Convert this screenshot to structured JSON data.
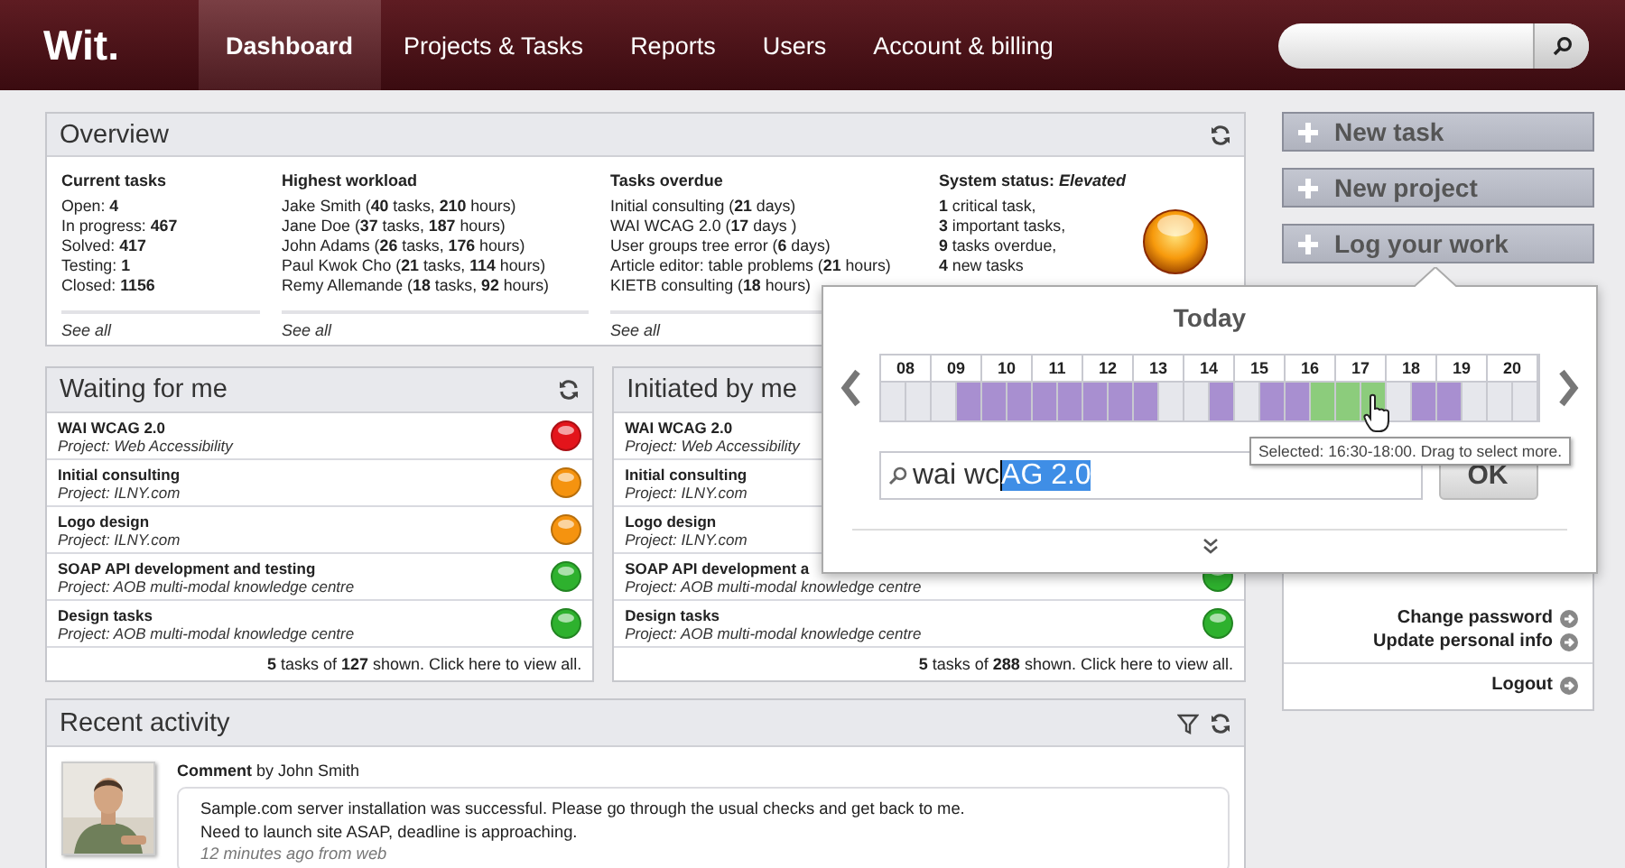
{
  "header": {
    "logo": "Wit.",
    "nav": [
      {
        "label": "Dashboard",
        "selected": true
      },
      {
        "label": "Projects & Tasks",
        "selected": false
      },
      {
        "label": "Reports",
        "selected": false
      },
      {
        "label": "Users",
        "selected": false
      },
      {
        "label": "Account & billing",
        "selected": false
      }
    ]
  },
  "overview": {
    "title": "Overview",
    "columns": [
      {
        "title": "Current tasks",
        "lines": [
          "Open: **4**",
          "In progress: **467**",
          "Solved: **417**",
          "Testing: **1**",
          "Closed: **1156**"
        ],
        "link": "See all"
      },
      {
        "title": "Highest workload",
        "lines": [
          "Jake Smith (**40** tasks, **210** hours)",
          "Jane Doe (**37** tasks, **187** hours)",
          "John Adams (**26** tasks, **176** hours)",
          "Paul Kwok Cho (**21** tasks, **114** hours)",
          "Remy Allemande (**18** tasks, **92** hours)"
        ],
        "link": "See all"
      },
      {
        "title": "Tasks overdue",
        "lines": [
          "Initial consulting (**21** days)",
          "WAI WCAG 2.0 (**17** days )",
          "User groups tree error (**6** days)",
          "Article editor: table problems (**21** hours)",
          "KIETB consulting (**18** hours)"
        ],
        "link": "See all"
      },
      {
        "title": "System status: *Elevated*",
        "lines": [
          "**1** critical task,",
          "**3** important tasks,",
          "**9** tasks overdue,",
          "**4** new tasks"
        ],
        "kind": "status"
      }
    ]
  },
  "panels": [
    {
      "title": "Waiting for me",
      "refresh": true,
      "rows": [
        {
          "title": "WAI WCAG 2.0",
          "project": "Project: Web Accessibility",
          "color": "#e3141b"
        },
        {
          "title": "Initial consulting",
          "project": "Project: ILNY.com",
          "color": "#f5930f"
        },
        {
          "title": "Logo design",
          "project": "Project: ILNY.com",
          "color": "#f5930f"
        },
        {
          "title": "SOAP API development and testing",
          "project": "Project: AOB multi-modal knowledge centre",
          "color": "#2eb12e"
        },
        {
          "title": "Design tasks",
          "project": "Project: AOB multi-modal knowledge centre",
          "color": "#2eb12e"
        }
      ],
      "footer": "**5** tasks of **127** shown. Click here to view all."
    },
    {
      "title": "Initiated by me",
      "rows": [
        {
          "title": "WAI WCAG 2.0",
          "project": "Project: Web Accessibility"
        },
        {
          "title": "Initial consulting",
          "project": "Project: ILNY.com"
        },
        {
          "title": "Logo design",
          "project": "Project: ILNY.com"
        },
        {
          "title": "SOAP API development a",
          "project": "Project: AOB multi-modal knowledge centre",
          "color": "#2eb12e"
        },
        {
          "title": "Design tasks",
          "project": "Project: AOB multi-modal knowledge centre",
          "color": "#2eb12e"
        }
      ],
      "footer": "**5** tasks of **288** shown. Click here to view all."
    }
  ],
  "activity": {
    "title": "Recent activity",
    "entries": [
      {
        "kind": "picture",
        "heading": "**Comment** by John Smith",
        "lines": [
          "Sample.com server installation was successful. Please go through the usual checks and get back to me.",
          "Need to launch site ASAP, deadline is approaching."
        ],
        "time": "12 minutes ago from web"
      }
    ]
  },
  "sidebar": {
    "actions": [
      "New task",
      "New project",
      "Log your work"
    ],
    "links": [
      "Change password",
      "Update personal info"
    ],
    "logout": "Logout"
  },
  "popup": {
    "title": "Today",
    "hours": [
      "08",
      "09",
      "10",
      "11",
      "12",
      "13",
      "14",
      "15",
      "16",
      "17",
      "18",
      "19",
      "20"
    ],
    "slots": [
      {
        "kind": "free"
      },
      {
        "kind": "free"
      },
      {
        "kind": "free"
      },
      {
        "kind": "logged"
      },
      {
        "kind": "logged"
      },
      {
        "kind": "logged"
      },
      {
        "kind": "logged"
      },
      {
        "kind": "logged"
      },
      {
        "kind": "logged"
      },
      {
        "kind": "logged"
      },
      {
        "kind": "logged"
      },
      {
        "kind": "free"
      },
      {
        "kind": "free"
      },
      {
        "kind": "logged"
      },
      {
        "kind": "free"
      },
      {
        "kind": "logged"
      },
      {
        "kind": "logged"
      },
      {
        "kind": "selected"
      },
      {
        "kind": "selected"
      },
      {
        "kind": "selected"
      },
      {
        "kind": "free"
      },
      {
        "kind": "logged"
      },
      {
        "kind": "logged"
      },
      {
        "kind": "free"
      },
      {
        "kind": "free"
      },
      {
        "kind": "free"
      }
    ],
    "typed": "wai wc",
    "highlighted": "AG 2.0",
    "button": "OK",
    "tooltip": "Selected: 16:30-18:00. Drag to select more."
  }
}
